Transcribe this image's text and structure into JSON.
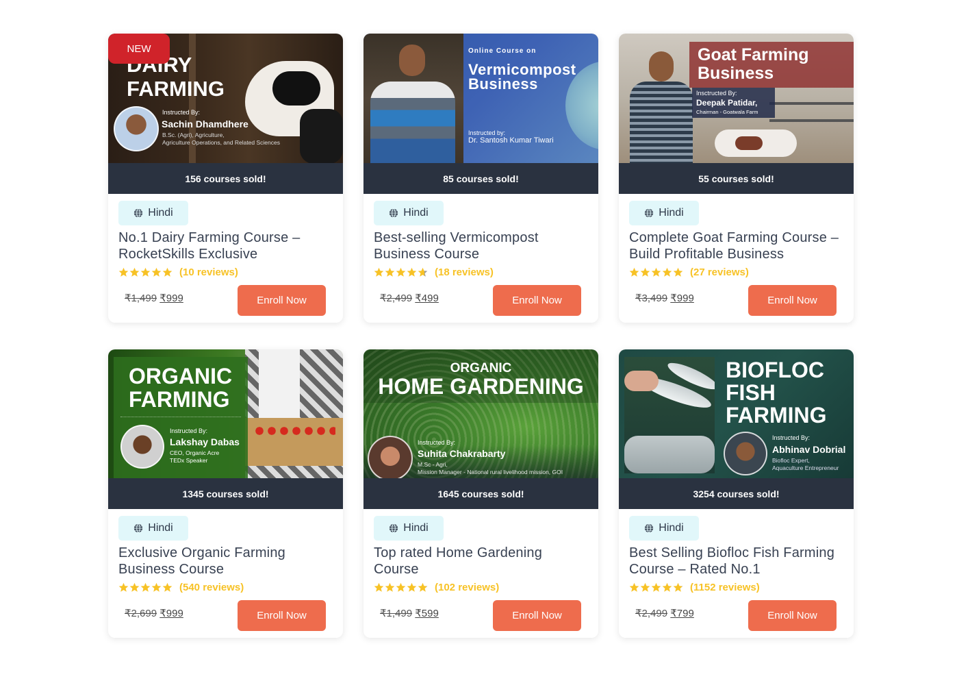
{
  "colors": {
    "sold_bar": "#2a3240",
    "enroll_button": "#ee6c4d",
    "language_badge": "#e1f7fa",
    "star": "#f7c226",
    "new_badge": "#d0232a"
  },
  "courses": [
    {
      "badge": "NEW",
      "thumbnail": {
        "heading": [
          "DAIRY",
          "FARMING"
        ],
        "instructed_label": "Instructed By:",
        "instructor": "Sachin Dhamdhere",
        "credentials": [
          "B.Sc. (Agri), Agriculture,",
          "Agriculture Operations, and Related Sciences"
        ]
      },
      "sold": "156 courses sold!",
      "language_icon": "globe-icon",
      "language": "Hindi",
      "title": "No.1 Dairy Farming Course – RocketSkills Exclusive",
      "rating": 5.0,
      "reviews": "(10 reviews)",
      "old_price": "₹1,499",
      "price": "₹999",
      "button": "Enroll Now"
    },
    {
      "thumbnail": {
        "kicker": "Online Course on",
        "heading": [
          "Vermicompost",
          "Business"
        ],
        "instructed_label": "Instructed by:",
        "instructor": "Dr. Santosh Kumar Tiwari"
      },
      "sold": "85 courses sold!",
      "language_icon": "globe-icon",
      "language": "Hindi",
      "title": "Best-selling Vermicompost Business Course",
      "rating": 4.7,
      "reviews": "(18 reviews)",
      "old_price": "₹2,499",
      "price": "₹499",
      "button": "Enroll Now"
    },
    {
      "thumbnail": {
        "heading": [
          "Goat Farming",
          "Business"
        ],
        "instructed_label": "Insctructed By:",
        "instructor": "Deepak Patidar,",
        "credentials": [
          "Chairman - Goatwala Farm"
        ]
      },
      "sold": "55 courses sold!",
      "language_icon": "globe-icon",
      "language": "Hindi",
      "title": "Complete Goat Farming Course – Build Profitable Business",
      "rating": 5.0,
      "reviews": "(27 reviews)",
      "old_price": "₹3,499",
      "price": "₹999",
      "button": "Enroll Now"
    },
    {
      "thumbnail": {
        "heading": [
          "ORGANIC",
          "FARMING"
        ],
        "instructed_label": "Instructed By:",
        "instructor": "Lakshay Dabas",
        "credentials": [
          "CEO, Organic Acre",
          "TEDx Speaker"
        ]
      },
      "sold": "1345 courses sold!",
      "language_icon": "globe-icon",
      "language": "Hindi",
      "title": "Exclusive Organic Farming Business Course",
      "rating": 5.0,
      "reviews": "(540 reviews)",
      "old_price": "₹2,699",
      "price": "₹999",
      "button": "Enroll Now"
    },
    {
      "thumbnail": {
        "kicker": "ORGANIC",
        "heading": [
          "HOME GARDENING"
        ],
        "instructed_label": "Instructed By:",
        "instructor": "Suhita Chakrabarty",
        "credentials": [
          "M.Sc - Agri,",
          "Mission Manager - National rural livelihood mission, GOI"
        ]
      },
      "sold": "1645 courses sold!",
      "language_icon": "globe-icon",
      "language": "Hindi",
      "title": "Top rated Home Gardening Course",
      "rating": 4.9,
      "reviews": "(102 reviews)",
      "old_price": "₹1,499",
      "price": "₹599",
      "button": "Enroll Now"
    },
    {
      "thumbnail": {
        "heading": [
          "BIOFLOC",
          "FISH",
          "FARMING"
        ],
        "instructed_label": "Instructed By:",
        "instructor": "Abhinav Dobrial",
        "credentials": [
          "Biofloc Expert,",
          "Aquaculture Entrepreneur"
        ]
      },
      "sold": "3254 courses sold!",
      "language_icon": "globe-icon",
      "language": "Hindi",
      "title": "Best Selling Biofloc Fish Farming Course – Rated No.1",
      "rating": 4.9,
      "reviews": "(1152 reviews)",
      "old_price": "₹2,499",
      "price": "₹799",
      "button": "Enroll Now"
    }
  ]
}
